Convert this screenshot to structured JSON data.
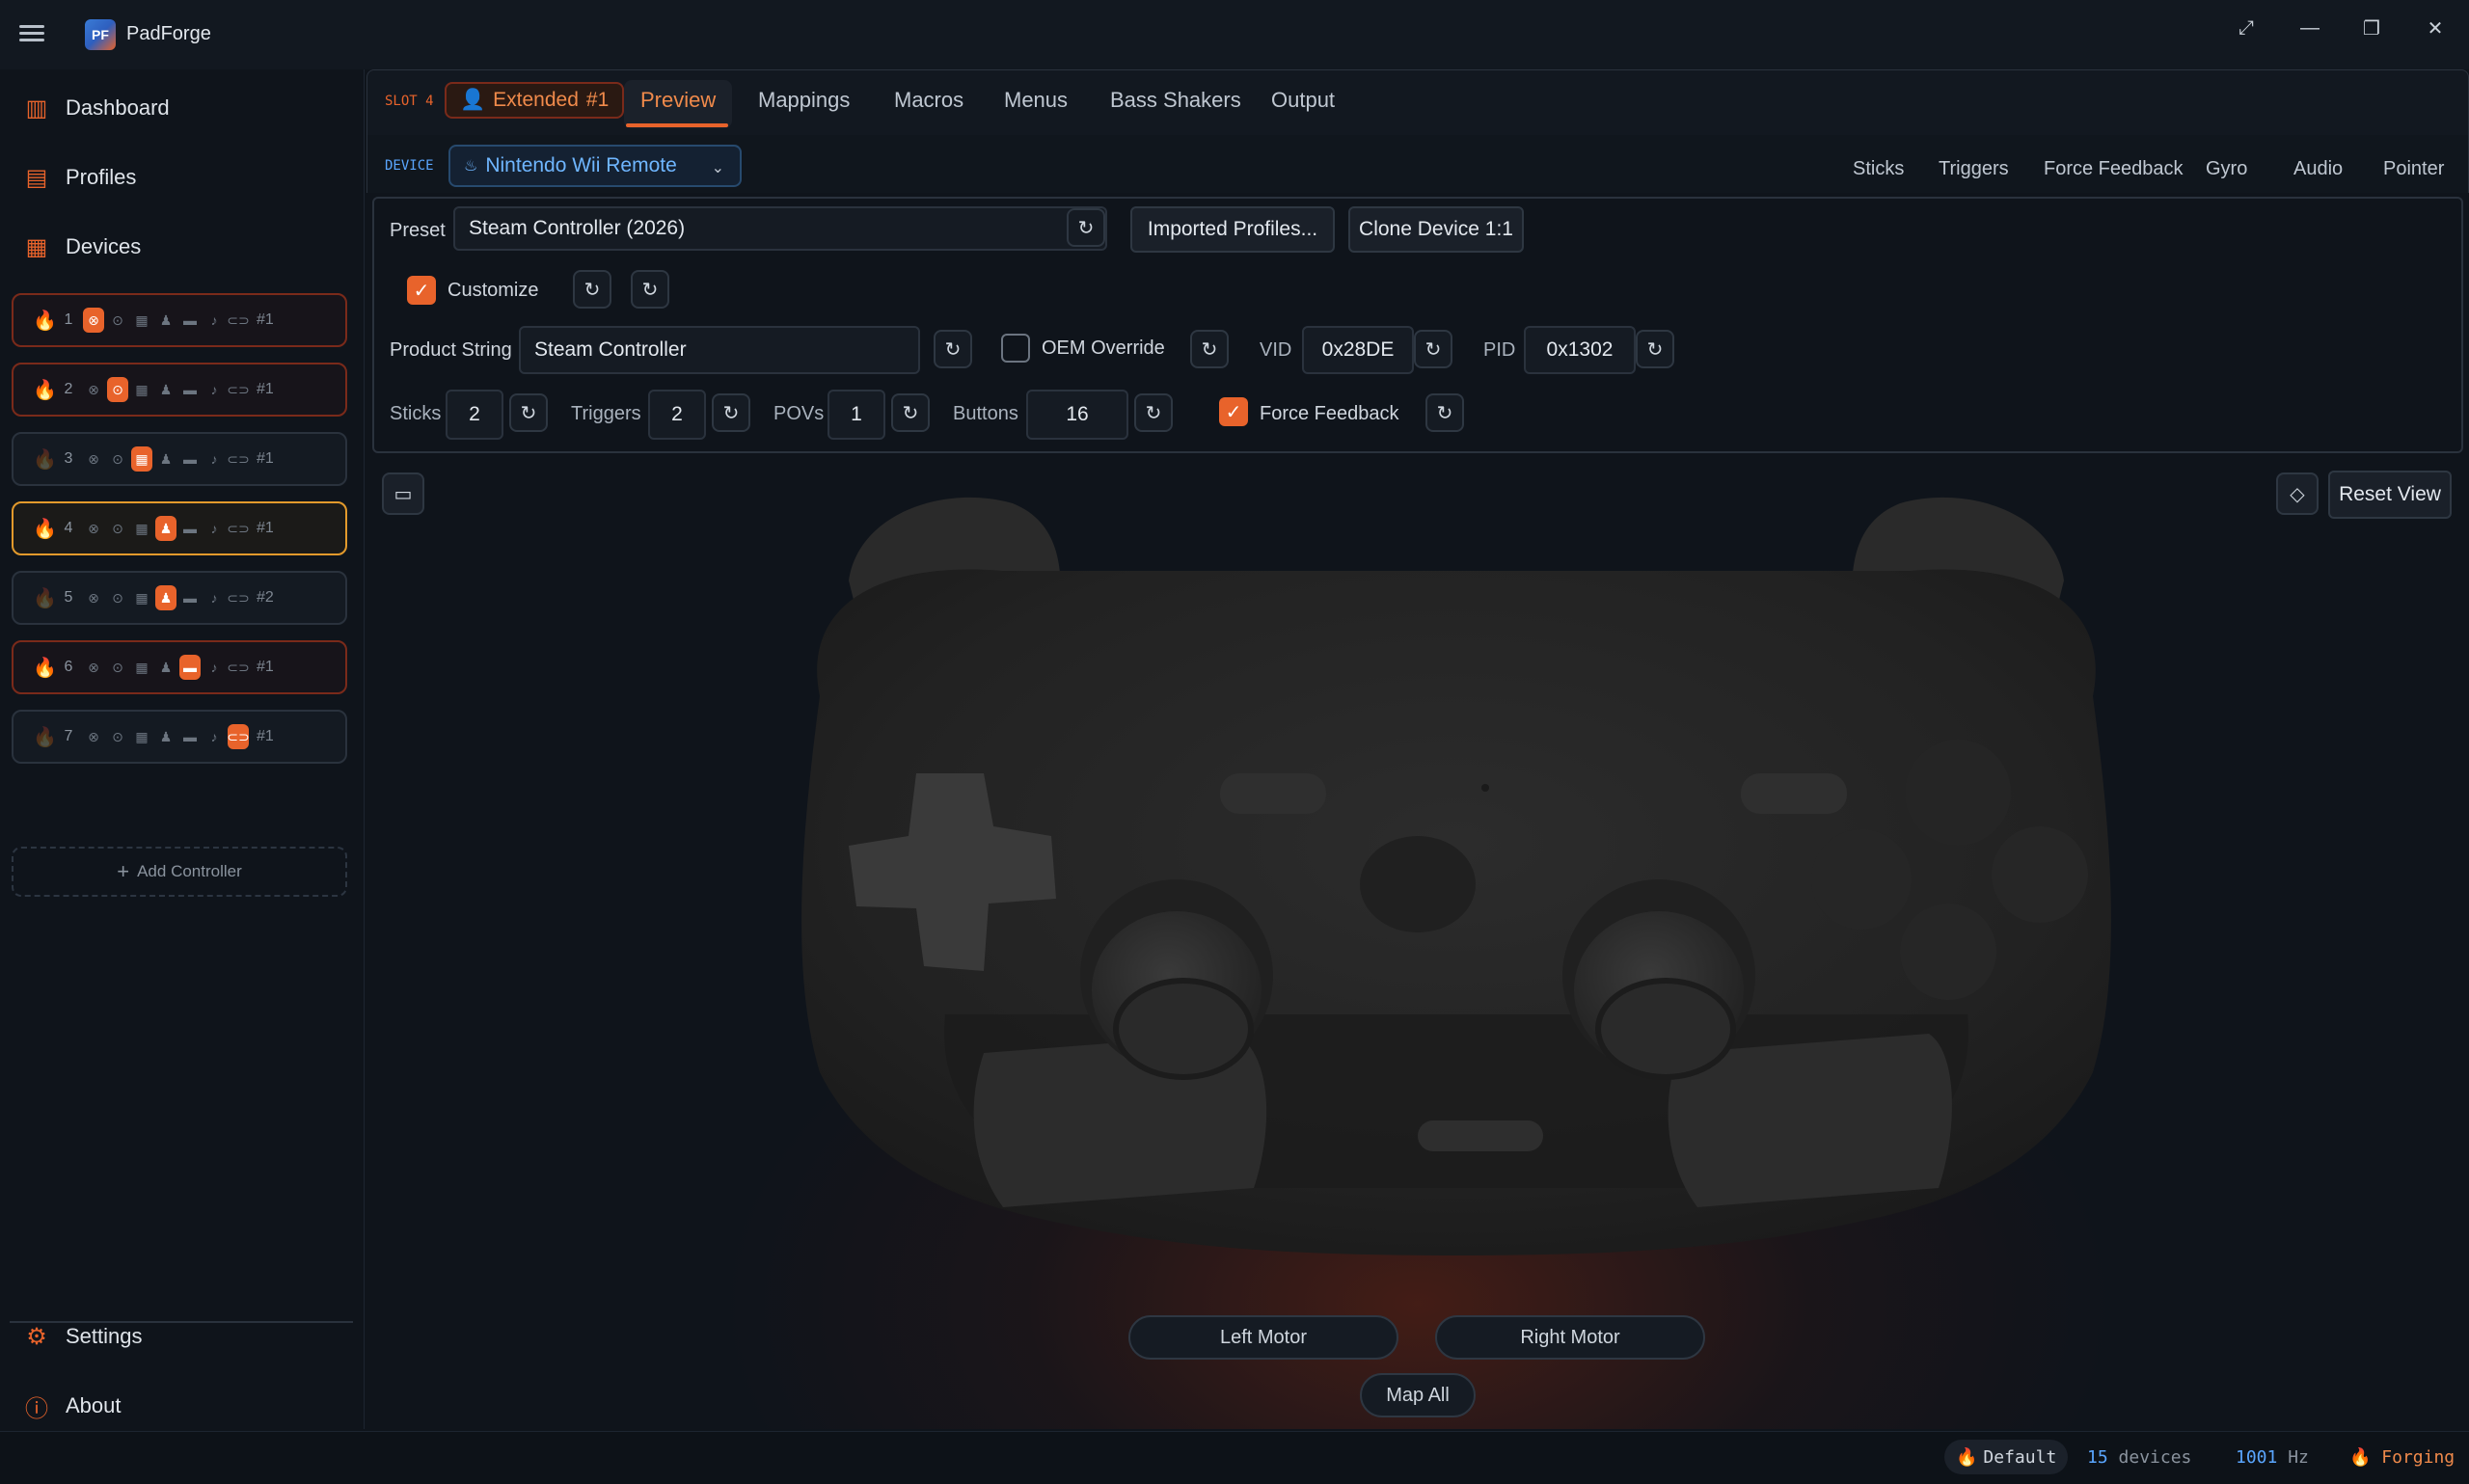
{
  "app": {
    "title": "PadForge",
    "logo_text": "PF"
  },
  "window_controls": {
    "expand": "⤢",
    "minimize": "—",
    "restore": "❐",
    "close": "✕"
  },
  "sidebar": {
    "nav": [
      {
        "label": "Dashboard",
        "icon": "dashboard-icon"
      },
      {
        "label": "Profiles",
        "icon": "profiles-icon"
      },
      {
        "label": "Devices",
        "icon": "devices-icon"
      }
    ],
    "slots": [
      {
        "number": "1",
        "tag": "#1",
        "active_icon": 0,
        "state": "active"
      },
      {
        "number": "2",
        "tag": "#1",
        "active_icon": 1,
        "state": "active"
      },
      {
        "number": "3",
        "tag": "#1",
        "active_icon": 2,
        "state": "idle"
      },
      {
        "number": "4",
        "tag": "#1",
        "active_icon": 3,
        "state": "selected"
      },
      {
        "number": "5",
        "tag": "#2",
        "active_icon": 3,
        "state": "idle"
      },
      {
        "number": "6",
        "tag": "#1",
        "active_icon": 4,
        "state": "active"
      },
      {
        "number": "7",
        "tag": "#1",
        "active_icon": 6,
        "state": "idle"
      }
    ],
    "add_controller": "Add Controller",
    "bottom": [
      {
        "label": "Settings",
        "icon": "gear-icon"
      },
      {
        "label": "About",
        "icon": "info-icon"
      }
    ]
  },
  "tabs": {
    "slot_label": "SLOT 4",
    "extended_label": "Extended",
    "extended_tag": "#1",
    "items": [
      "Preview",
      "Mappings",
      "Macros",
      "Menus",
      "Bass Shakers",
      "Output"
    ],
    "active": "Preview"
  },
  "device": {
    "label": "DEVICE",
    "selected": "Nintendo Wii Remote",
    "subtabs": [
      "Sticks",
      "Triggers",
      "Force Feedback",
      "Gyro",
      "Audio",
      "Pointer"
    ]
  },
  "config": {
    "preset_label": "Preset",
    "preset_value": "Steam Controller (2026)",
    "imported_profiles": "Imported Profiles...",
    "clone_device": "Clone Device 1:1",
    "customize_label": "Customize",
    "customize_checked": true,
    "product_string_label": "Product String",
    "product_string_value": "Steam Controller",
    "oem_override_label": "OEM Override",
    "oem_override_checked": false,
    "vid_label": "VID",
    "vid_value": "0x28DE",
    "pid_label": "PID",
    "pid_value": "0x1302",
    "sticks_label": "Sticks",
    "sticks_value": "2",
    "triggers_label": "Triggers",
    "triggers_value": "2",
    "povs_label": "POVs",
    "povs_value": "1",
    "buttons_label": "Buttons",
    "buttons_value": "16",
    "force_feedback_label": "Force Feedback",
    "force_feedback_checked": true
  },
  "preview": {
    "reset_view": "Reset View",
    "left_motor": "Left Motor",
    "right_motor": "Right Motor",
    "map_all": "Map All"
  },
  "status": {
    "profile": "Default",
    "devices_count": "15",
    "devices_word": "devices",
    "rate_value": "1001",
    "rate_unit": "Hz",
    "engine_state": "Forging"
  },
  "colors": {
    "accent": "#e8632b",
    "accent_text": "#f08a4b",
    "link_blue": "#5aa6ff",
    "background": "#0f141b",
    "selected_slot_border": "#e39a2c"
  }
}
